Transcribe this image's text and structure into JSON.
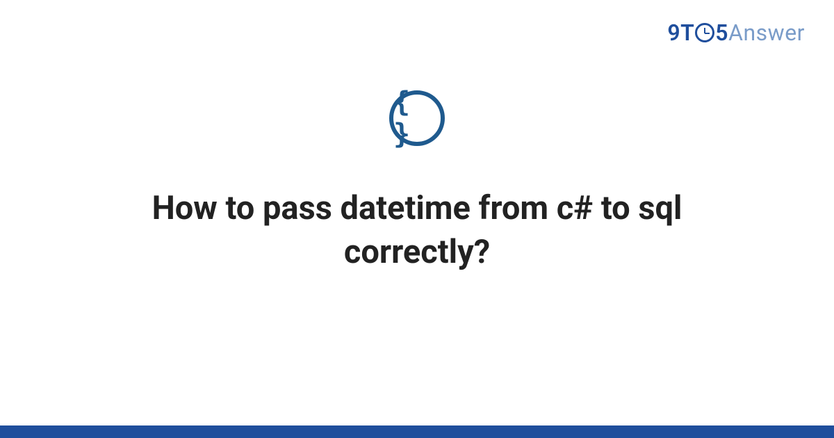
{
  "logo": {
    "prefix": "9T",
    "suffix_digit": "5",
    "suffix_word": "Answer"
  },
  "icon": {
    "glyph": "{ }",
    "name": "code-braces"
  },
  "question": {
    "title": "How to pass datetime from c# to sql correctly?"
  },
  "colors": {
    "brand_primary": "#1f4e9c",
    "brand_secondary": "#7a9cc9",
    "icon_ring": "#1f5a8e",
    "text": "#222222"
  }
}
